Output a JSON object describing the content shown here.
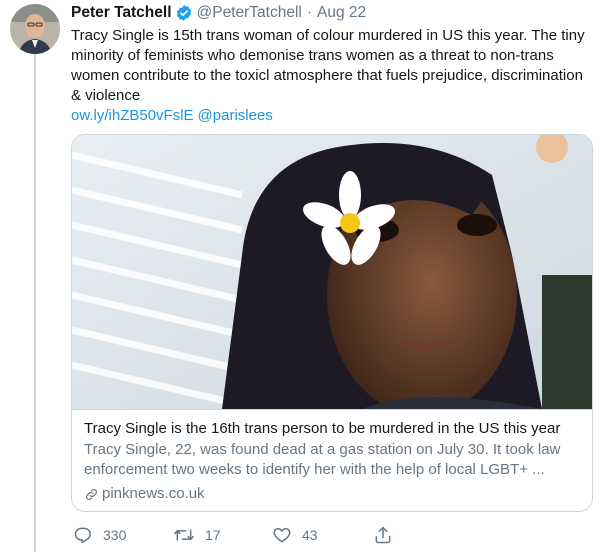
{
  "author": {
    "name": "Peter Tatchell",
    "handle": "@PeterTatchell",
    "separator": "·",
    "date": "Aug 22",
    "verified_color": "#1da1f2"
  },
  "tweet": {
    "text": "Tracy Single is 15th trans woman of colour murdered in US this year. The tiny minority of feminists who demonise trans women as a threat to non-trans women contribute to the toxicl atmosphere that fuels prejudice, discrimination & violence",
    "link": "ow.ly/ihZB50vFslE",
    "mention": "@parislees"
  },
  "card": {
    "title": "Tracy Single is the 16th trans person to be murdered in the US this year",
    "description": "Tracy Single, 22, was found dead at a gas station on July 30. It took law enforcement two weeks to identify her with the help of local LGBT+ ...",
    "domain": "pinknews.co.uk",
    "image_icon": "photo-of-woman-with-flower"
  },
  "actions": {
    "reply_count": "330",
    "retweet_count": "17",
    "like_count": "43"
  },
  "colors": {
    "link": "#1b95e0",
    "secondary": "#657786",
    "border": "#ccd6dd"
  }
}
